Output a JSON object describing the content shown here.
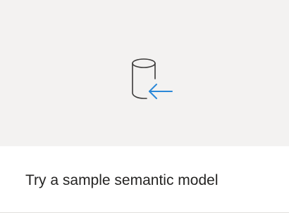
{
  "card": {
    "label": "Try a sample semantic model",
    "icon": "database-import-icon"
  },
  "colors": {
    "preview_background": "#f3f2f1",
    "icon_outline": "#3b3a39",
    "arrow_accent": "#2b88d8",
    "label_text": "#252423"
  }
}
